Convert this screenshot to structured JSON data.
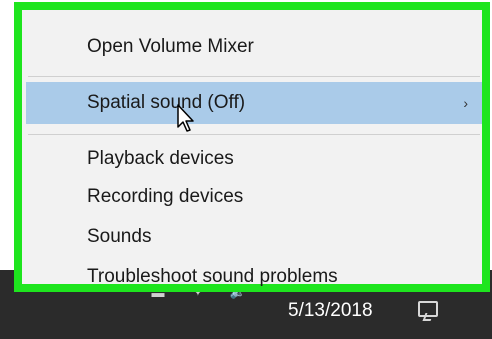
{
  "menu": {
    "items": [
      {
        "label": "Open Volume Mixer"
      },
      {
        "label": "Spatial sound (Off)",
        "submenu_arrow": "›",
        "highlighted": true
      },
      {
        "label": "Playback devices"
      },
      {
        "label": "Recording devices"
      },
      {
        "label": "Sounds"
      },
      {
        "label": "Troubleshoot sound problems"
      }
    ]
  },
  "taskbar": {
    "date": "5/13/2018",
    "icons": [
      "chevron-up-icon",
      "battery-icon",
      "network-icon",
      "volume-icon",
      "notification-icon"
    ],
    "background": "#2b2b2b"
  },
  "colors": {
    "highlight_border": "#1ee51e",
    "menu_background": "#f2f2f2",
    "hover_background": "#aacbe9"
  }
}
